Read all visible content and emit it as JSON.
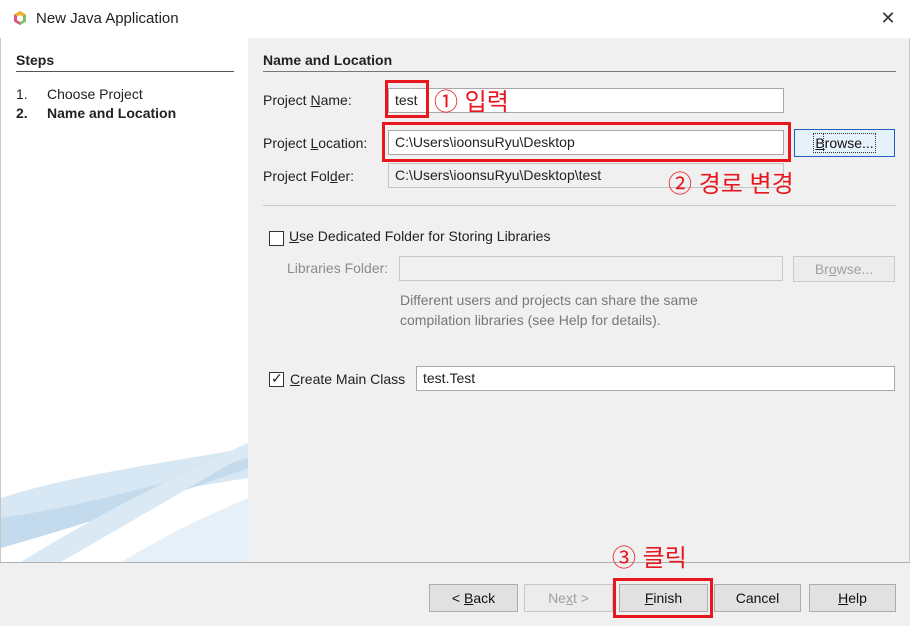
{
  "window": {
    "title": "New Java Application",
    "close_symbol": "✕"
  },
  "steps": {
    "title": "Steps",
    "items": [
      {
        "num": "1.",
        "label": "Choose Project"
      },
      {
        "num": "2.",
        "label": "Name and Location"
      }
    ]
  },
  "section": {
    "title": "Name and Location"
  },
  "form": {
    "project_name": {
      "label_pre": "Project ",
      "label_mn": "N",
      "label_post": "ame:",
      "value": "test"
    },
    "project_location": {
      "label_pre": "Project ",
      "label_mn": "L",
      "label_post": "ocation:",
      "value": "C:\\Users\\ioonsuRyu\\Desktop"
    },
    "project_folder": {
      "label_pre": "Project Fol",
      "label_mn": "d",
      "label_post": "er:",
      "value": "C:\\Users\\ioonsuRyu\\Desktop\\test"
    },
    "browse": {
      "label_pre": "",
      "label_mn": "B",
      "label_post": "rowse..."
    },
    "dedicated_folder": {
      "checked": false,
      "label_mn": "U",
      "label_post": "se Dedicated Folder for Storing Libraries"
    },
    "libraries_folder": {
      "label": "Libraries Folder:",
      "value": "",
      "browse_pre": "Br",
      "browse_mn": "o",
      "browse_post": "wse..."
    },
    "hint_line1": "Different users and projects can share the same",
    "hint_line2": "compilation libraries (see Help for details).",
    "create_main_class": {
      "checked": true,
      "label_mn": "C",
      "label_post": "reate Main Class",
      "value": "test.Test",
      "check_symbol": "✓"
    }
  },
  "buttons": {
    "back": {
      "arrow": "<",
      "mn": "B",
      "post": "ack"
    },
    "next": {
      "pre": "Ne",
      "mn": "x",
      "post": "t",
      "arrow": ">"
    },
    "finish": {
      "mn": "F",
      "post": "inish"
    },
    "cancel": {
      "label": "Cancel"
    },
    "help": {
      "mn": "H",
      "post": "elp"
    }
  },
  "annotations": {
    "note1": "① 입력",
    "note2": "② 경로 변경",
    "note3": "③ 클릭",
    "color": "#e8161e"
  },
  "colors": {
    "panel": "#f0f0f0",
    "accent": "#1f5fbf"
  }
}
